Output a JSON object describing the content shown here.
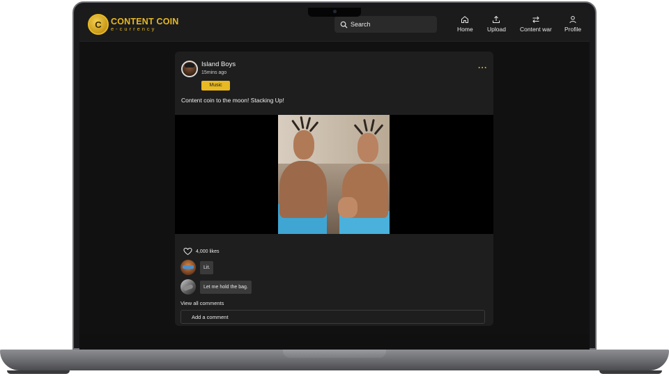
{
  "brand": {
    "title": "CONTENT COIN",
    "subtitle": "e-currency",
    "coin_glyph": "C"
  },
  "search": {
    "placeholder": "Search"
  },
  "nav": {
    "home": "Home",
    "upload": "Upload",
    "content_war": "Content war",
    "profile": "Profile"
  },
  "post": {
    "author": "Island Boys",
    "time": "15mins ago",
    "tag": "Music",
    "more": "···",
    "caption": "Content coin to the moon! Stacking Up!",
    "likes": "4,000 likes",
    "comments": [
      {
        "text": "Lit."
      },
      {
        "text": "Let me hold the bag."
      }
    ],
    "view_all": "View  all comments",
    "add_comment_placeholder": "Add a comment"
  },
  "colors": {
    "accent": "#e8b923",
    "background": "#111112",
    "card": "#1e1e1f"
  },
  "icons": [
    "search-icon",
    "home-icon",
    "upload-icon",
    "content-war-icon",
    "profile-icon",
    "more-icon",
    "heart-icon"
  ]
}
